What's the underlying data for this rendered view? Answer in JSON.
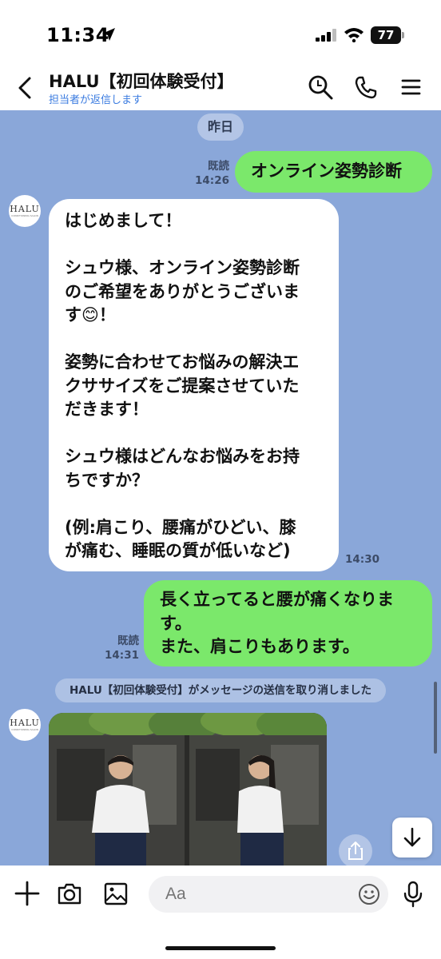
{
  "status_bar": {
    "time": "11:34",
    "battery": "77"
  },
  "header": {
    "title": "HALU【初回体験受付】",
    "subtitle": "担当者が返信します"
  },
  "chat": {
    "date_label": "昨日",
    "messages": [
      {
        "direction": "outgoing",
        "text": "オンライン姿勢診断",
        "read_label": "既読",
        "time": "14:26"
      },
      {
        "direction": "incoming",
        "text": "はじめまして！\n\nシュウ様、オンライン姿勢診断\nのご希望をありがとうございま\nす😊！\n\n姿勢に合わせてお悩みの解決エ\nクササイズをご提案させていた\nだきます！\n\nシュウ様はどんなお悩みをお持\nちですか？\n\n(例:肩こり、腰痛がひどい、膝\nが痛む、睡眠の質が低いなど)",
        "time": "14:30"
      },
      {
        "direction": "outgoing",
        "text": "長く立ってると腰が痛くなりま\nす。\nまた、肩こりもあります。",
        "read_label": "既読",
        "time": "14:31"
      }
    ],
    "system_notice": "HALU【初回体験受付】がメッセージの送信を取り消しました",
    "avatar": {
      "logo_text": "HALU",
      "logo_subtext": "CONDITIONING SALON"
    }
  },
  "input": {
    "placeholder": "Aa"
  },
  "icons": [
    "location-arrow-icon",
    "signal-icon",
    "wifi-icon",
    "back-chevron-icon",
    "search-icon",
    "phone-icon",
    "menu-icon",
    "share-icon",
    "arrow-down-icon",
    "plus-icon",
    "camera-icon",
    "image-icon",
    "emoji-icon",
    "mic-icon"
  ],
  "colors": {
    "chat_background": "#8aa7d9",
    "outgoing_bubble": "#7be86b",
    "incoming_bubble": "#ffffff",
    "subtitle_link": "#3a7be0"
  }
}
